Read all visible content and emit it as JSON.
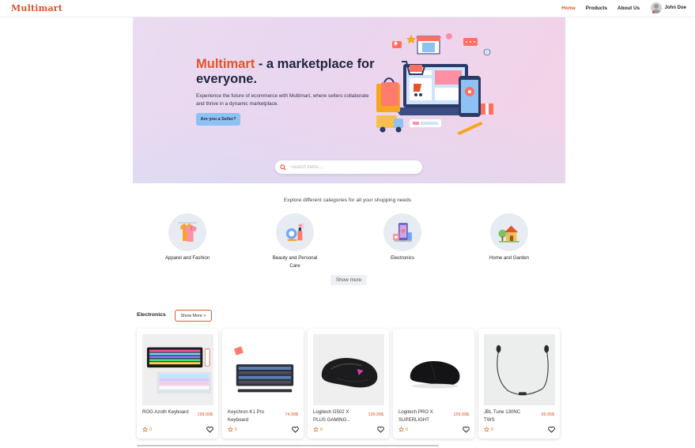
{
  "navbar": {
    "logo": "Multimart",
    "links": [
      {
        "label": "Home",
        "active": true
      },
      {
        "label": "Products",
        "active": false
      },
      {
        "label": "About Us",
        "active": false
      }
    ],
    "user_name": "John Doe"
  },
  "hero": {
    "title_brand": "Multimart",
    "title_rest": " - a marketplace for everyone.",
    "description": "Experience the future of ecommerce with Multimart, where sellers collaborate and thrive in a dynamic marketplace.",
    "seller_button": "Are you a Seller?",
    "search_placeholder": "Search items..."
  },
  "categories": {
    "heading": "Explore different categories for all your shopping needs",
    "items": [
      {
        "label": "Apparel and Fashion",
        "icon": "apparel-icon"
      },
      {
        "label": "Beauty and Personal Care",
        "icon": "beauty-icon"
      },
      {
        "label": "Electronics",
        "icon": "electronics-icon"
      },
      {
        "label": "Home and Garden",
        "icon": "home-garden-icon"
      }
    ],
    "show_more": "Show more"
  },
  "electronics": {
    "title": "Electronics",
    "show_more": "Show More >",
    "products": [
      {
        "name": "ROG Azoth Keyboard",
        "price": "199.99$",
        "rating": "0"
      },
      {
        "name": "Keychron K1 Pro Keyboard",
        "price": "74.99$",
        "rating": "0"
      },
      {
        "name": "Logitech G502 X PLUS GAMING...",
        "price": "139.99$",
        "rating": "0"
      },
      {
        "name": "Logitech PRO X SUPERLIGHT",
        "price": "159.99$",
        "rating": "0"
      },
      {
        "name": "JBL Tune 130NC TWS",
        "price": "99.95$",
        "rating": "0"
      }
    ]
  },
  "colors": {
    "accent": "#e0552b",
    "seller_button": "#8ec2f2"
  }
}
